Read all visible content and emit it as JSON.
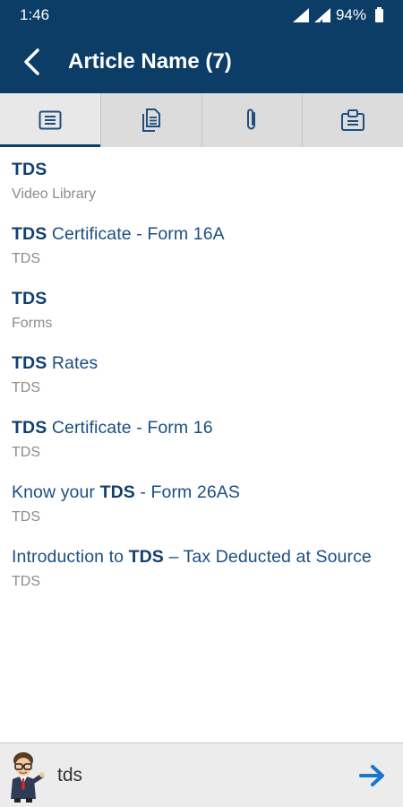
{
  "status_bar": {
    "time": "1:46",
    "battery": "94%"
  },
  "header": {
    "title": "Article Name (7)",
    "back_icon": "back-chevron-icon"
  },
  "tabs": [
    {
      "icon": "article-list-icon",
      "active": true
    },
    {
      "icon": "documents-icon",
      "active": false
    },
    {
      "icon": "attachment-icon",
      "active": false
    },
    {
      "icon": "clipboard-card-icon",
      "active": false
    }
  ],
  "results": [
    {
      "pre": "",
      "bold": "TDS",
      "post": "",
      "source": "Video Library"
    },
    {
      "pre": "",
      "bold": "TDS",
      "post": " Certificate - Form 16A",
      "source": "TDS"
    },
    {
      "pre": "",
      "bold": "TDS",
      "post": "",
      "source": "Forms"
    },
    {
      "pre": "",
      "bold": "TDS",
      "post": " Rates",
      "source": "TDS"
    },
    {
      "pre": "",
      "bold": "TDS",
      "post": " Certificate - Form 16",
      "source": "TDS"
    },
    {
      "pre": "Know your ",
      "bold": "TDS",
      "post": " - Form 26AS",
      "source": "TDS"
    },
    {
      "pre": "Introduction to ",
      "bold": "TDS",
      "post": " – Tax Deducted at Source",
      "source": "TDS"
    }
  ],
  "chat": {
    "input_value": "tds",
    "send_icon": "send-arrow-icon",
    "avatar_icon": "assistant-avatar-icon"
  },
  "colors": {
    "primary": "#0b3d66",
    "link": "#1b4f82",
    "muted": "#8c8c8c",
    "send": "#1976c9"
  }
}
